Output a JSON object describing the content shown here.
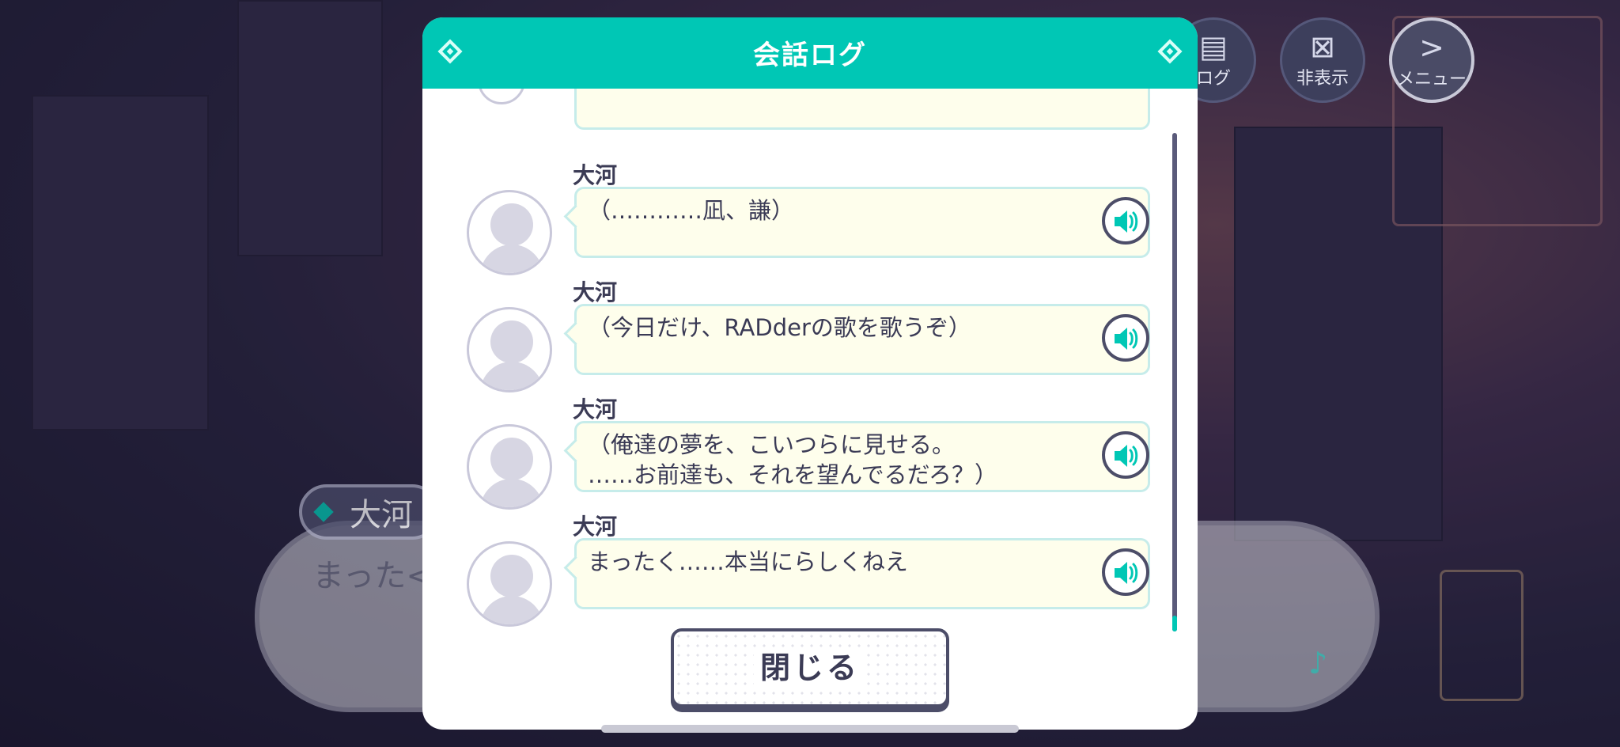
{
  "top_buttons": {
    "log_label": "ログ",
    "hide_label": "非表示",
    "menu_label": "メニュー"
  },
  "background_dialog": {
    "speaker": "大河",
    "text": "まった<"
  },
  "log_modal": {
    "title": "会話ログ",
    "close_label": "閉じる",
    "entries": [
      {
        "speaker": "大河",
        "text": "（…………凪、謙）"
      },
      {
        "speaker": "大河",
        "text": "（今日だけ、RADderの歌を歌うぞ）"
      },
      {
        "speaker": "大河",
        "text": "（俺達の夢を、こいつらに見せる。\n……お前達も、それを望んでるだろ？）"
      },
      {
        "speaker": "大河",
        "text": "まったく……本当にらしくねえ"
      }
    ]
  },
  "colors": {
    "accent": "#00c7b5",
    "bubble_bg": "#fefeec",
    "bubble_border": "#c6ecea",
    "text_dark": "#3b3b55"
  }
}
